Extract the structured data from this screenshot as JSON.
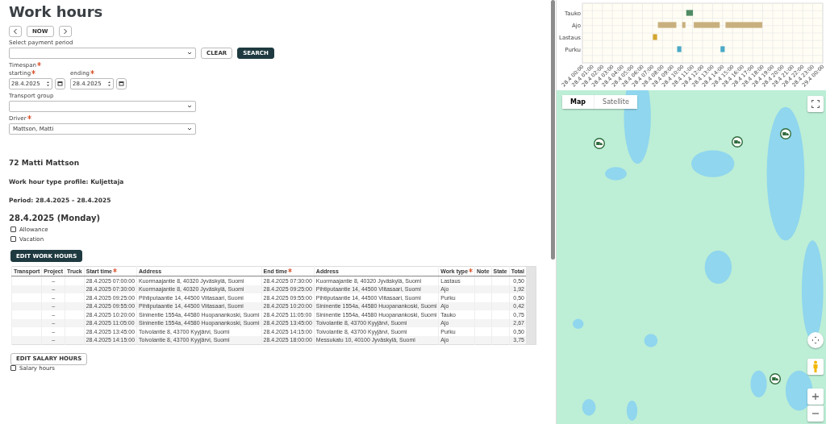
{
  "page": {
    "title": "Work hours"
  },
  "nav": {
    "now": "NOW"
  },
  "payment_period": {
    "label": "Select payment period",
    "clear": "CLEAR",
    "search": "SEARCH"
  },
  "timespan": {
    "label": "Timespan",
    "required": true,
    "starting": {
      "label": "starting",
      "required": true,
      "value": "28.4.2025"
    },
    "ending": {
      "label": "ending",
      "required": true,
      "value": "28.4.2025"
    }
  },
  "transport_group": {
    "label": "Transport group",
    "required": false
  },
  "driver": {
    "label": "Driver",
    "required": true,
    "value": "Mattson, Matti"
  },
  "summary": {
    "name": "72 Matti Mattson",
    "profile": "Work hour type profile: Kuljettaja",
    "period": "Period: 28.4.2025 – 28.4.2025",
    "day": "28.4.2025 (Monday)"
  },
  "day_options": [
    {
      "label": "Allowance",
      "checked": false
    },
    {
      "label": "Vacation",
      "checked": false
    }
  ],
  "edit_work_hours": "EDIT WORK HOURS",
  "table": {
    "columns": [
      {
        "label": "Transport",
        "required": false
      },
      {
        "label": "Project",
        "required": false
      },
      {
        "label": "Truck",
        "required": false
      },
      {
        "label": "Start time",
        "required": true
      },
      {
        "label": "Address",
        "required": false
      },
      {
        "label": "End time",
        "required": true
      },
      {
        "label": "Address",
        "required": false
      },
      {
        "label": "Work type",
        "required": true
      },
      {
        "label": "Note",
        "required": false
      },
      {
        "label": "State",
        "required": false
      },
      {
        "label": "Total",
        "required": false
      }
    ],
    "rows": [
      {
        "project": "–",
        "start": "28.4.2025 07:00:00",
        "start_address": "Kuormaajantie 8, 40320 Jyväskylä, Suomi",
        "end": "28.4.2025 07:30:00",
        "end_address": "Kuormaajantie 8, 40320 Jyväskylä, Suomi",
        "work_type": "Lastaus",
        "total": "0,50"
      },
      {
        "project": "–",
        "start": "28.4.2025 07:30:00",
        "start_address": "Kuormaajantie 8, 40320 Jyväskylä, Suomi",
        "end": "28.4.2025 09:25:00",
        "end_address": "Pihtiputaantie 14, 44500 Viitasaari, Suomi",
        "work_type": "Ajo",
        "total": "1,92"
      },
      {
        "project": "–",
        "start": "28.4.2025 09:25:00",
        "start_address": "Pihtiputaantie 14, 44500 Viitasaari, Suomi",
        "end": "28.4.2025 09:55:00",
        "end_address": "Pihtiputaantie 14, 44500 Viitasaari, Suomi",
        "work_type": "Purku",
        "total": "0,50"
      },
      {
        "project": "–",
        "start": "28.4.2025 09:55:00",
        "start_address": "Pihtiputaantie 14, 44500 Viitasaari, Suomi",
        "end": "28.4.2025 10:20:00",
        "end_address": "Sininentie 1554a, 44580 Huopanankoski, Suomi",
        "work_type": "Ajo",
        "total": "0,42"
      },
      {
        "project": "–",
        "start": "28.4.2025 10:20:00",
        "start_address": "Sininentie 1554a, 44580 Huopanankoski, Suomi",
        "end": "28.4.2025 11:05:00",
        "end_address": "Sininentie 1554a, 44580 Huopanankoski, Suomi",
        "work_type": "Tauko",
        "total": "0,75"
      },
      {
        "project": "–",
        "start": "28.4.2025 11:05:00",
        "start_address": "Sininentie 1554a, 44580 Huopanankoski, Suomi",
        "end": "28.4.2025 13:45:00",
        "end_address": "Toivolantie 8, 43700 Kyyjärvi, Suomi",
        "work_type": "Ajo",
        "total": "2,67"
      },
      {
        "project": "–",
        "start": "28.4.2025 13:45:00",
        "start_address": "Toivolantie 8, 43700 Kyyjärvi, Suomi",
        "end": "28.4.2025 14:15:00",
        "end_address": "Toivolantie 8, 43700 Kyyjärvi, Suomi",
        "work_type": "Purku",
        "total": "0,50"
      },
      {
        "project": "–",
        "start": "28.4.2025 14:15:00",
        "start_address": "Toivolantie 8, 43700 Kyyjärvi, Suomi",
        "end": "28.4.2025 18:00:00",
        "end_address": "Messukatu 10, 40100 Jyväskylä, Suomi",
        "work_type": "Ajo",
        "total": "3,75"
      }
    ]
  },
  "edit_salary_hours": "EDIT SALARY HOURS",
  "salary_options": [
    {
      "label": "Salary hours",
      "checked": false
    }
  ],
  "timeline": {
    "rows": [
      {
        "label": "Tauko",
        "color": "#4e8b64"
      },
      {
        "label": "Ajo",
        "color": "#c8b07e"
      },
      {
        "label": "Lastaus",
        "color": "#d2a630"
      },
      {
        "label": "Purku",
        "color": "#4aa9c6"
      }
    ],
    "tick_labels": [
      "28.4 00:00",
      "28.4 01:00",
      "28.4 02:00",
      "28.4 03:00",
      "28.4 04:00",
      "28.4 05:00",
      "28.4 06:00",
      "28.4 07:00",
      "28.4 08:00",
      "28.4 09:00",
      "28.4 10:00",
      "28.4 11:00",
      "28.4 12:00",
      "28.4 13:00",
      "28.4 14:00",
      "28.4 15:00",
      "28.4 16:00",
      "28.4 17:00",
      "28.4 18:00",
      "28.4 19:00",
      "28.4 20:00",
      "28.4 21:00",
      "28.4 22:00",
      "28.4 23:00",
      "29.4 00:00"
    ]
  },
  "map": {
    "tabs": [
      {
        "label": "Map",
        "selected": true
      },
      {
        "label": "Satellite",
        "selected": false
      }
    ]
  }
}
